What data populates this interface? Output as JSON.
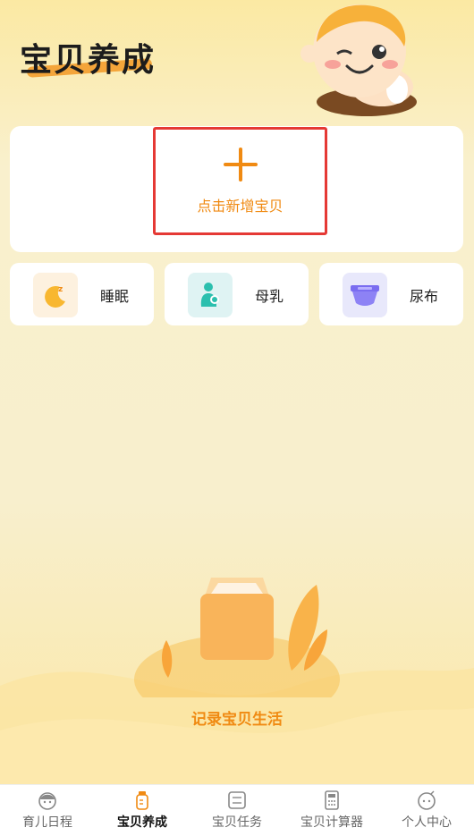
{
  "header": {
    "title": "宝贝养成"
  },
  "add_card": {
    "label": "点击新增宝贝",
    "accent": "#f08a12",
    "highlight_border": "#e53935"
  },
  "tiles": [
    {
      "label": "睡眠",
      "icon": "moon-sleep-icon",
      "bg": "#fdf1df"
    },
    {
      "label": "母乳",
      "icon": "breastfeeding-icon",
      "bg": "#dff3f3"
    },
    {
      "label": "尿布",
      "icon": "diaper-icon",
      "bg": "#e8e8fb"
    }
  ],
  "empty_state": {
    "text": "记录宝贝生活"
  },
  "nav": {
    "items": [
      {
        "label": "育儿日程",
        "icon": "baby-face-icon",
        "active": false
      },
      {
        "label": "宝贝养成",
        "icon": "bottle-icon",
        "active": true
      },
      {
        "label": "宝贝任务",
        "icon": "task-list-icon",
        "active": false
      },
      {
        "label": "宝贝计算器",
        "icon": "calculator-icon",
        "active": false
      },
      {
        "label": "个人中心",
        "icon": "profile-face-icon",
        "active": false
      }
    ]
  }
}
